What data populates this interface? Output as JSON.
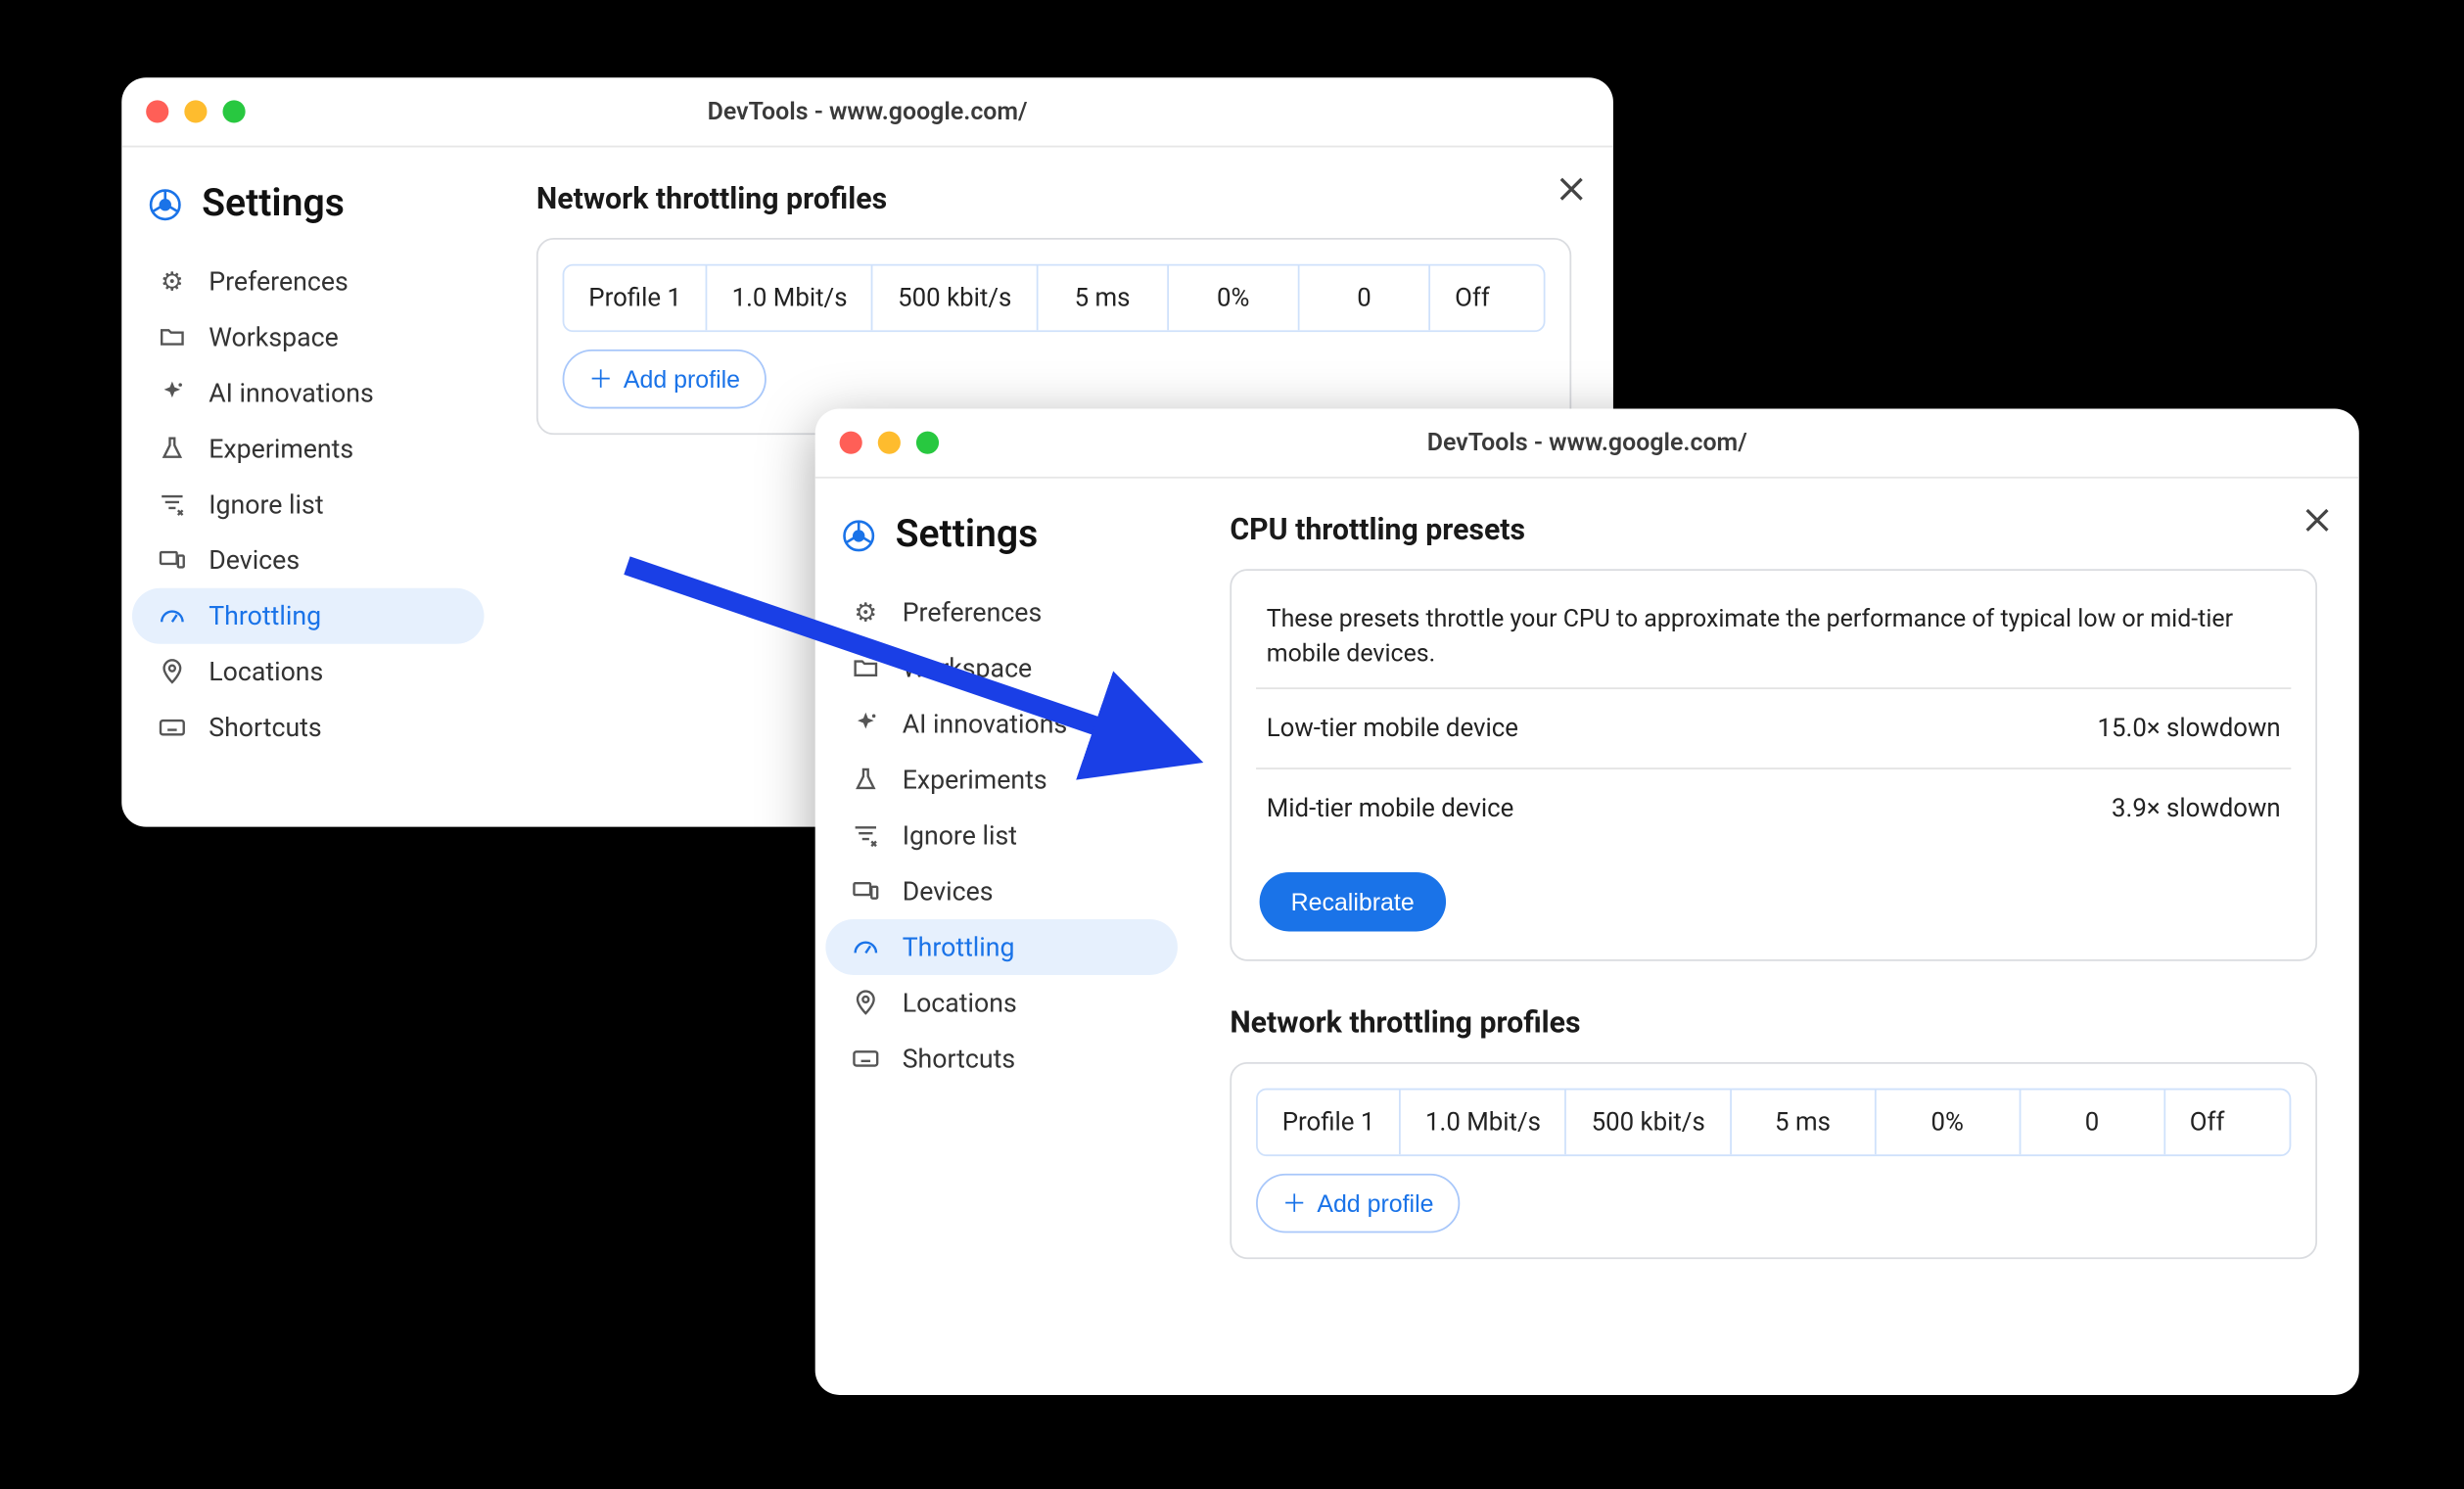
{
  "window_title": "DevTools - www.google.com/",
  "settings_title": "Settings",
  "sidebar": {
    "items": [
      {
        "label": "Preferences"
      },
      {
        "label": "Workspace"
      },
      {
        "label": "AI innovations"
      },
      {
        "label": "Experiments"
      },
      {
        "label": "Ignore list"
      },
      {
        "label": "Devices"
      },
      {
        "label": "Throttling"
      },
      {
        "label": "Locations"
      },
      {
        "label": "Shortcuts"
      }
    ],
    "active_index": 6
  },
  "network_section": {
    "heading": "Network throttling profiles",
    "add_label": "Add profile",
    "profile": {
      "name": "Profile 1",
      "down": "1.0 Mbit/s",
      "up": "500 kbit/s",
      "latency": "5 ms",
      "packet_loss": "0%",
      "queue": "0",
      "reliability": "Off"
    }
  },
  "cpu_section": {
    "heading": "CPU throttling presets",
    "description": "These presets throttle your CPU to approximate the performance of typical low or mid-tier mobile devices.",
    "rows": [
      {
        "label": "Low-tier mobile device",
        "value": "15.0× slowdown"
      },
      {
        "label": "Mid-tier mobile device",
        "value": "3.9× slowdown"
      }
    ],
    "button": "Recalibrate"
  }
}
